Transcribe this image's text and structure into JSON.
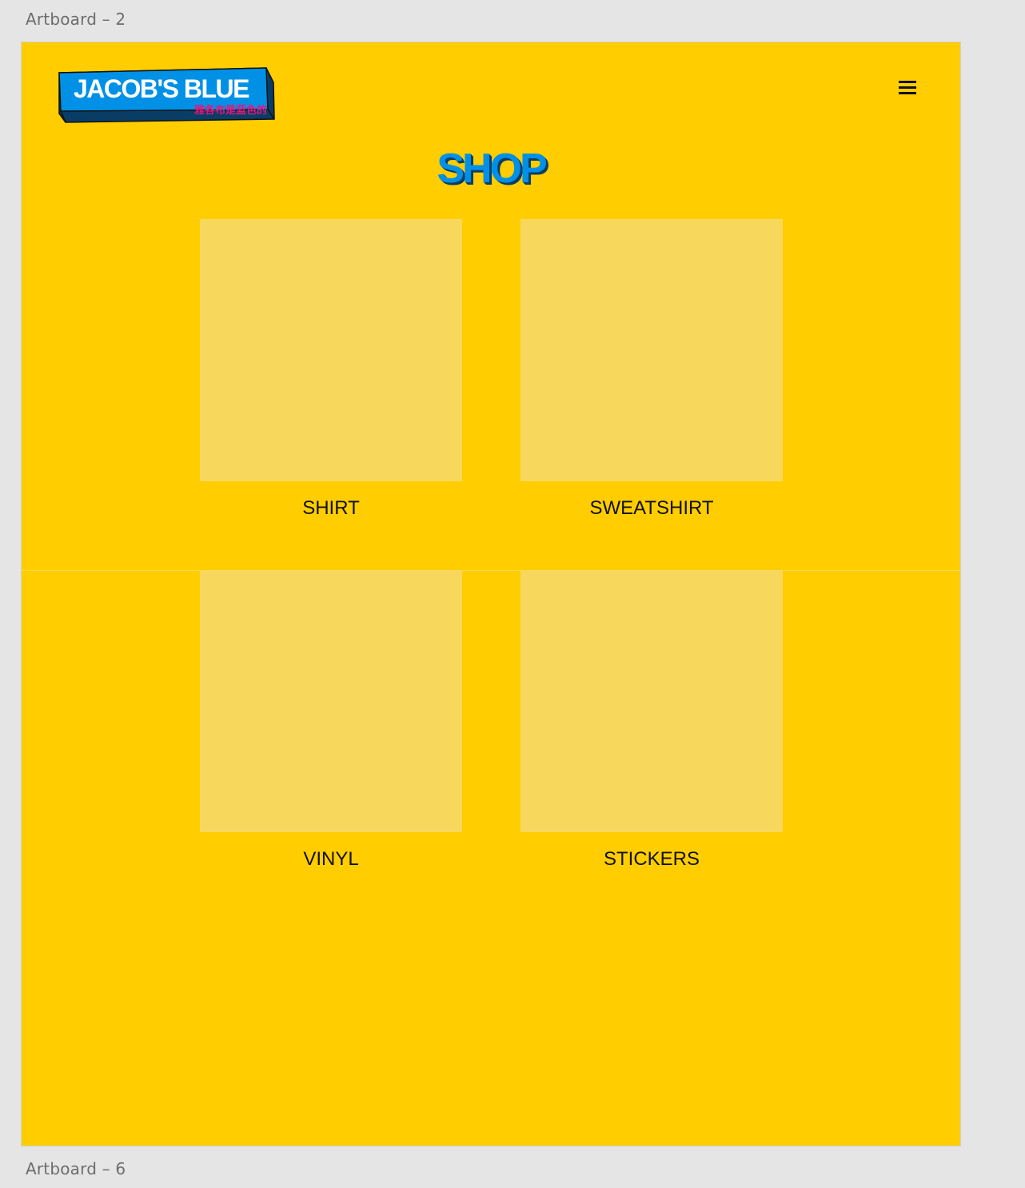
{
  "canvas": {
    "artboard_top_label": "Artboard – 2",
    "artboard_bottom_label": "Artboard – 6"
  },
  "header": {
    "logo_text": "JACOB'S BLUE",
    "logo_subtext": "雅各布是蓝色的",
    "menu_icon": "hamburger-menu-icon"
  },
  "main": {
    "title": "SHOP",
    "products": [
      {
        "label": "SHIRT"
      },
      {
        "label": "SWEATSHIRT"
      },
      {
        "label": "VINYL"
      },
      {
        "label": "STICKERS"
      }
    ]
  },
  "colors": {
    "background": "#ffcd00",
    "tile_placeholder": "#f8d85c",
    "logo_blue": "#0091e6",
    "logo_dark": "#0a3d66",
    "logo_accent_pink": "#e8157a",
    "canvas_gray": "#e5e5e5"
  }
}
